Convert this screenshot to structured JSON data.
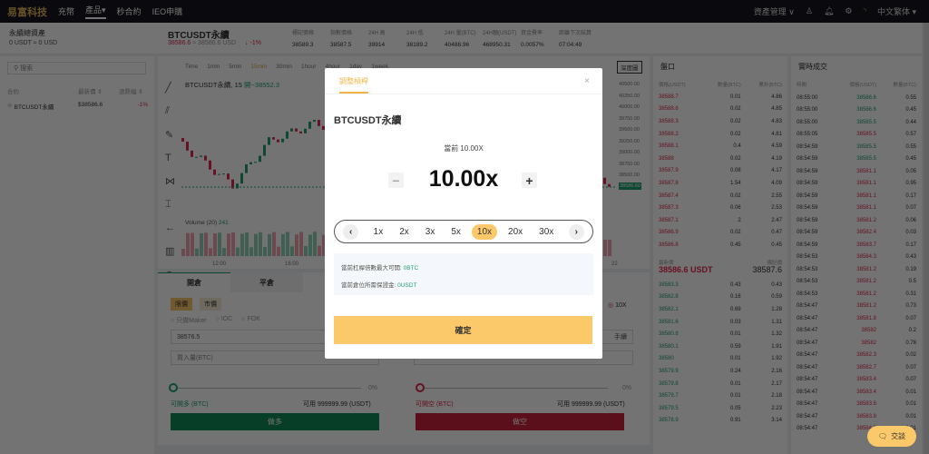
{
  "nav": {
    "logo": "易富科技",
    "links": [
      "充幣",
      "產品▾",
      "秒合約",
      "IEO申購"
    ],
    "asset_mgmt": "資產管理 ∨",
    "language": "中文繁体 ▾"
  },
  "account": {
    "title": "永續總資產",
    "balance": "0 USDT ≈ 0 USD",
    "search_placeholder": "搜索",
    "cols": [
      "合約",
      "最新價 ⇕",
      "漲跌幅 ⇕"
    ],
    "items": [
      {
        "symbol": "BTCUSDT永續",
        "price": "$38586.6",
        "change": "-1%"
      }
    ]
  },
  "ticker": {
    "symbol": "BTCUSDT永續",
    "price": "38586.6",
    "usd": "≈ 38586.6 USD",
    "change": "↓ -1%",
    "stats": [
      {
        "label": "標記價格",
        "value": "38589.3"
      },
      {
        "label": "指數價格",
        "value": "38587.5"
      },
      {
        "label": "24H 高",
        "value": "39914"
      },
      {
        "label": "24H 低",
        "value": "38189.2"
      },
      {
        "label": "24H 量(BTC)",
        "value": "40488.96"
      },
      {
        "label": "24H額(USDT)",
        "value": "468950.31"
      },
      {
        "label": "資金費率",
        "value": "0.0057%"
      },
      {
        "label": "距離下次結算",
        "value": "07:04:49"
      }
    ]
  },
  "chart": {
    "intervals": [
      "Time",
      "1min",
      "5min",
      "15min",
      "30min",
      "1hour",
      "4hour",
      "1day",
      "1week"
    ],
    "active_interval": "15min",
    "legend": "BTCUSDT永續, 15",
    "open": "開~38552.3",
    "volume_label": "Volume (20)",
    "volume_value": "241",
    "price_axis": [
      "40500.00",
      "40250.00",
      "40000.00",
      "39750.00",
      "39500.00",
      "39250.00",
      "39000.00",
      "38750.00",
      "38500.00",
      "38250.00"
    ],
    "last_tag": "38586.60",
    "vol_axis": [
      "500",
      "250",
      "0"
    ],
    "time_axis": [
      "12:00",
      "16:00",
      "22"
    ],
    "depth_btn": "深度圖"
  },
  "order": {
    "tabs": [
      "開倉",
      "平倉"
    ],
    "types": [
      "限價",
      "市價"
    ],
    "options": [
      "只做Maker",
      "IOC",
      "FOK"
    ],
    "price": "38576.5",
    "amount_placeholder": "買入量(BTC)",
    "leverage": "10X",
    "pct": "0%",
    "long_avail": "可開多 (BTC)",
    "short_avail": "可開空 (BTC)",
    "usable": "可用 999999.99 (USDT)",
    "long_btn": "做多",
    "short_btn": "做空",
    "hand": "手續"
  },
  "orderbook": {
    "title": "盤口",
    "cols": [
      "價格(USDT)",
      "數量(BTC)",
      "累計(BTC)"
    ],
    "asks": [
      [
        "38588.7",
        "0.01",
        "4.86"
      ],
      [
        "38588.6",
        "0.02",
        "4.85"
      ],
      [
        "38588.3",
        "0.02",
        "4.83"
      ],
      [
        "38588.2",
        "0.02",
        "4.81"
      ],
      [
        "38588.1",
        "0.4",
        "4.59"
      ],
      [
        "38588",
        "0.02",
        "4.19"
      ],
      [
        "38587.9",
        "0.08",
        "4.17"
      ],
      [
        "38587.8",
        "1.54",
        "4.09"
      ],
      [
        "38587.4",
        "0.02",
        "2.55"
      ],
      [
        "38587.3",
        "0.06",
        "2.53"
      ],
      [
        "38587.1",
        "2",
        "2.47"
      ],
      [
        "38586.9",
        "0.02",
        "0.47"
      ],
      [
        "38586.8",
        "0.45",
        "0.45"
      ]
    ],
    "last_label": "最新價",
    "last": "38586.6 USDT",
    "mark_label": "標記價",
    "mark": "38587.6",
    "bids": [
      [
        "38583.3",
        "0.43",
        "0.43"
      ],
      [
        "38582.8",
        "0.16",
        "0.59"
      ],
      [
        "38582.1",
        "0.69",
        "1.28"
      ],
      [
        "38581.6",
        "0.03",
        "1.31"
      ],
      [
        "38580.8",
        "0.01",
        "1.32"
      ],
      [
        "38580.1",
        "0.59",
        "1.91"
      ],
      [
        "38580",
        "0.01",
        "1.92"
      ],
      [
        "38579.9",
        "0.24",
        "2.16"
      ],
      [
        "38579.8",
        "0.01",
        "2.17"
      ],
      [
        "38579.7",
        "0.01",
        "2.18"
      ],
      [
        "38579.5",
        "0.05",
        "2.23"
      ],
      [
        "38578.9",
        "0.91",
        "3.14"
      ]
    ]
  },
  "trades": {
    "title": "實時成交",
    "cols": [
      "時間",
      "價格(USDT)",
      "數量(BTC)"
    ],
    "rows": [
      [
        "08:55:00",
        "38586.6",
        "0.55",
        "g"
      ],
      [
        "08:55:00",
        "38586.6",
        "0.45",
        "g"
      ],
      [
        "08:55:00",
        "38585.5",
        "0.44",
        "g"
      ],
      [
        "08:55:05",
        "38585.5",
        "0.57",
        "r"
      ],
      [
        "08:54:59",
        "38585.5",
        "0.55",
        "g"
      ],
      [
        "08:54:59",
        "38585.5",
        "0.45",
        "g"
      ],
      [
        "08:54:59",
        "38581.1",
        "0.05",
        "r"
      ],
      [
        "08:54:59",
        "38581.1",
        "0.95",
        "r"
      ],
      [
        "08:54:59",
        "38581.1",
        "0.17",
        "r"
      ],
      [
        "08:54:59",
        "38581.1",
        "0.07",
        "r"
      ],
      [
        "08:54:59",
        "38581.2",
        "0.06",
        "r"
      ],
      [
        "08:54:59",
        "38582.4",
        "0.03",
        "r"
      ],
      [
        "08:54:59",
        "38583.7",
        "0.17",
        "r"
      ],
      [
        "08:54:53",
        "38584.3",
        "0.43",
        "r"
      ],
      [
        "08:54:53",
        "38581.2",
        "0.19",
        "r"
      ],
      [
        "08:54:53",
        "38581.2",
        "0.5",
        "r"
      ],
      [
        "08:54:53",
        "38581.2",
        "0.31",
        "r"
      ],
      [
        "08:54:47",
        "38581.2",
        "0.73",
        "r"
      ],
      [
        "08:54:47",
        "38581.8",
        "0.07",
        "r"
      ],
      [
        "08:54:47",
        "38582",
        "0.2",
        "r"
      ],
      [
        "08:54:47",
        "38582",
        "0.78",
        "r"
      ],
      [
        "08:54:47",
        "38582.3",
        "0.02",
        "r"
      ],
      [
        "08:54:47",
        "38582.7",
        "0.07",
        "r"
      ],
      [
        "08:54:47",
        "38583.4",
        "0.07",
        "r"
      ],
      [
        "08:54:47",
        "38583.4",
        "0.01",
        "r"
      ],
      [
        "08:54:47",
        "38583.6",
        "0.01",
        "r"
      ],
      [
        "08:54:47",
        "38583.8",
        "0.01",
        "r"
      ],
      [
        "08:54:47",
        "38584.3",
        "0.01",
        "r"
      ]
    ]
  },
  "modal": {
    "tab": "調整槓桿",
    "symbol": "BTCUSDT永續",
    "current": "當前 10.00X",
    "value": "10.00x",
    "options": [
      "1x",
      "2x",
      "3x",
      "5x",
      "10x",
      "20x",
      "30x"
    ],
    "selected": "10x",
    "max_open_label": "當前杠桿倍數最大可開:",
    "max_open": "0BTC",
    "margin_label": "當前倉位所需保證金:",
    "margin": "0USDT",
    "confirm": "確定"
  },
  "chat": {
    "label": "交談"
  },
  "colors": {
    "accent": "#fcc96a",
    "up": "#1f9f70",
    "down": "#e0294a"
  }
}
